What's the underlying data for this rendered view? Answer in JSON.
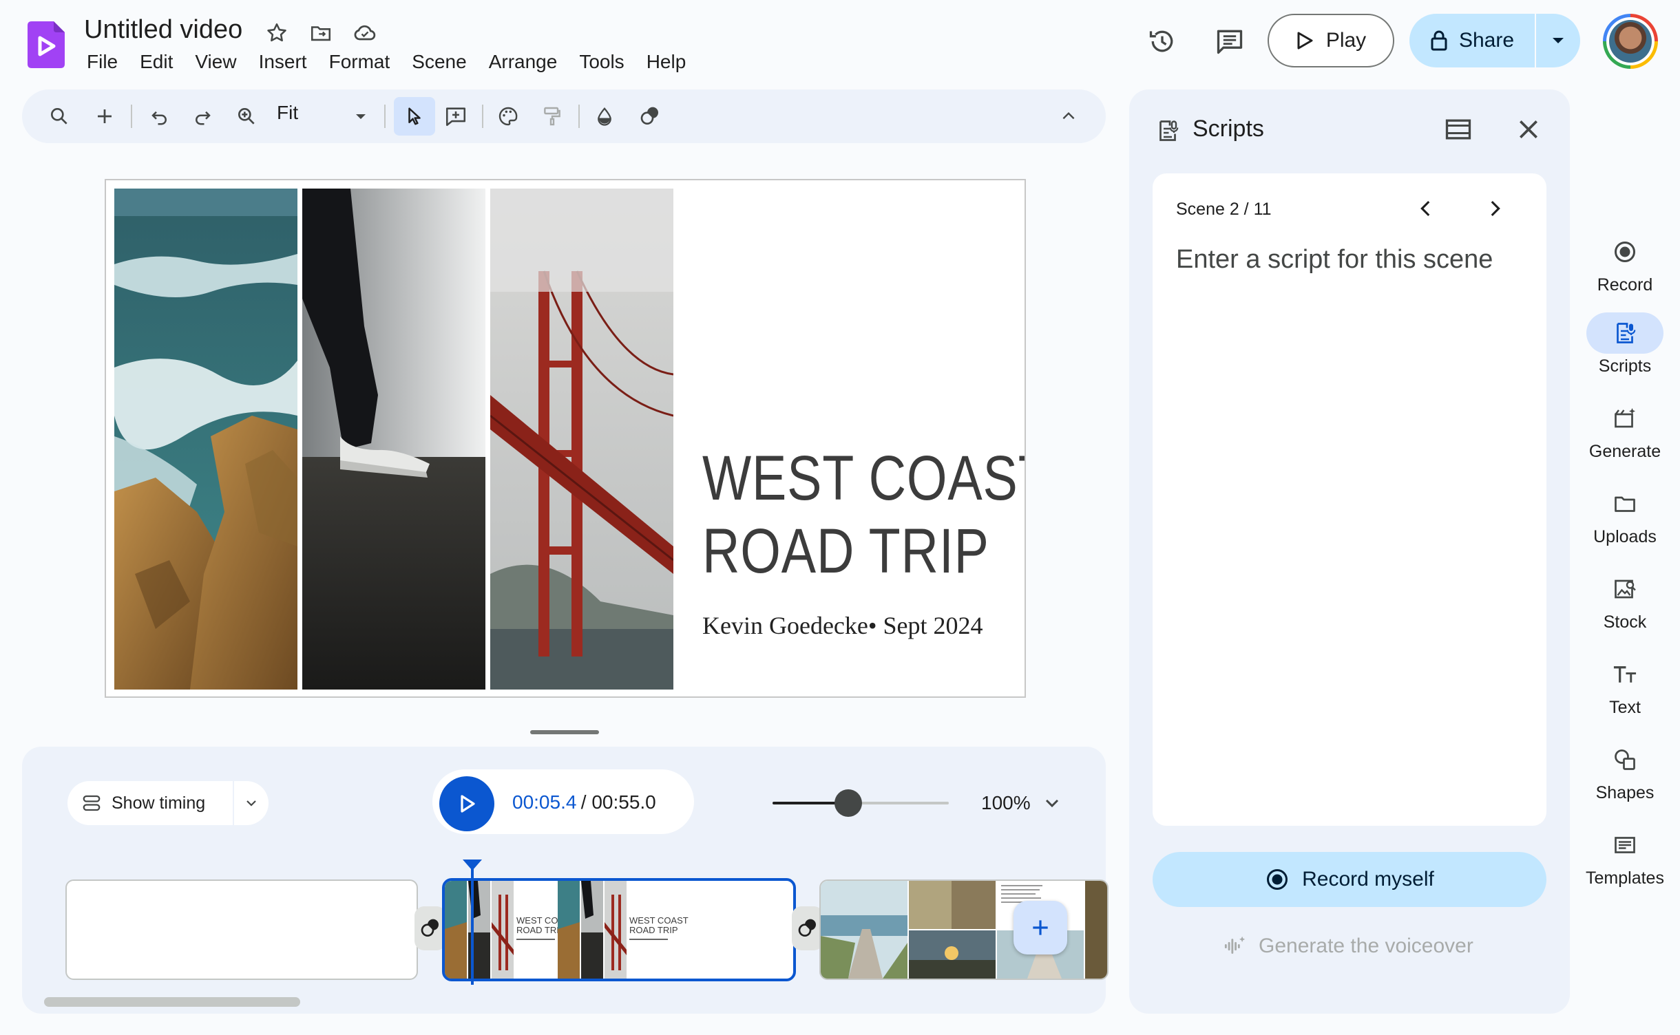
{
  "header": {
    "doc_title": "Untitled video",
    "menu": [
      "File",
      "Edit",
      "View",
      "Insert",
      "Format",
      "Scene",
      "Arrange",
      "Tools",
      "Help"
    ],
    "play_label": "Play",
    "share_label": "Share"
  },
  "toolbar": {
    "zoom_fit": "Fit"
  },
  "slide": {
    "title_line1": "WEST COAST",
    "title_line2": "ROAD TRIP",
    "subtitle": "Kevin Goedecke• Sept 2024"
  },
  "timeline": {
    "show_timing_label": "Show timing",
    "time_current": "00:05.4",
    "time_total": " / 00:55.0",
    "zoom_level": "100%",
    "zoom_slider_fraction": 0.43,
    "thumb_title_1": "WEST COAST",
    "thumb_title_2": "ROAD TRIP"
  },
  "scripts_panel": {
    "title": "Scripts",
    "scene_counter": "Scene 2 / 11",
    "script_placeholder": "Enter a script for this scene",
    "record_button": "Record myself",
    "generate_voiceover": "Generate the voiceover"
  },
  "rail": {
    "items": [
      {
        "label": "Record",
        "icon": "record-icon"
      },
      {
        "label": "Scripts",
        "icon": "scripts-icon"
      },
      {
        "label": "Generate",
        "icon": "generate-icon"
      },
      {
        "label": "Uploads",
        "icon": "uploads-icon"
      },
      {
        "label": "Stock",
        "icon": "stock-icon"
      },
      {
        "label": "Text",
        "icon": "text-icon"
      },
      {
        "label": "Shapes",
        "icon": "shapes-icon"
      },
      {
        "label": "Templates",
        "icon": "templates-icon"
      }
    ]
  },
  "colors": {
    "accent_blue": "#0b57d0",
    "share_bg": "#c2e7ff",
    "panel_bg": "#edf2fa",
    "selected_rail": "#d3e3fd",
    "logo_purple": "#a142f4"
  }
}
